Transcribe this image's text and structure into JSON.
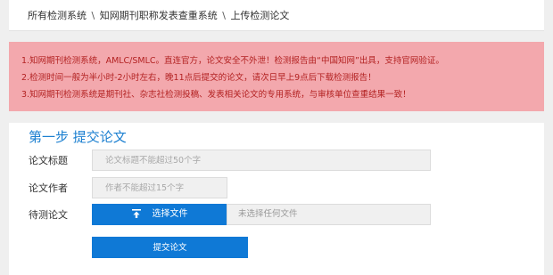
{
  "breadcrumb": {
    "items": [
      "所有检测系统",
      "知网期刊职称发表查重系统",
      "上传检测论文"
    ],
    "separator": "\\"
  },
  "notice": {
    "lines": [
      "1.知网期刊检测系统，AMLC/SMLC。直连官方，论文安全不外泄！检测报告由“中国知网”出具，支持官网验证。",
      "2.检测时间一般为半小时-2小时左右，晚11点后提交的论文，请次日早上9点后下载检测报告！",
      "3.知网期刊检测系统是期刊社、杂志社检测投稿、发表相关论文的专用系统，与审核单位查重结果一致！"
    ]
  },
  "form": {
    "step_title": "第一步 提交论文",
    "title_label": "论文标题",
    "title_placeholder": "论文标题不能超过50个字",
    "author_label": "论文作者",
    "author_placeholder": "作者不能超过15个字",
    "file_label": "待测论文",
    "file_button": "选择文件",
    "file_button_icon": "upload-icon",
    "file_status": "未选择任何文件",
    "submit_label": "提交论文"
  },
  "colors": {
    "accent": "#0f79d6",
    "notice_bg": "#f3a8ad",
    "notice_text": "#b32222",
    "title_blue": "#1b7fd0"
  }
}
